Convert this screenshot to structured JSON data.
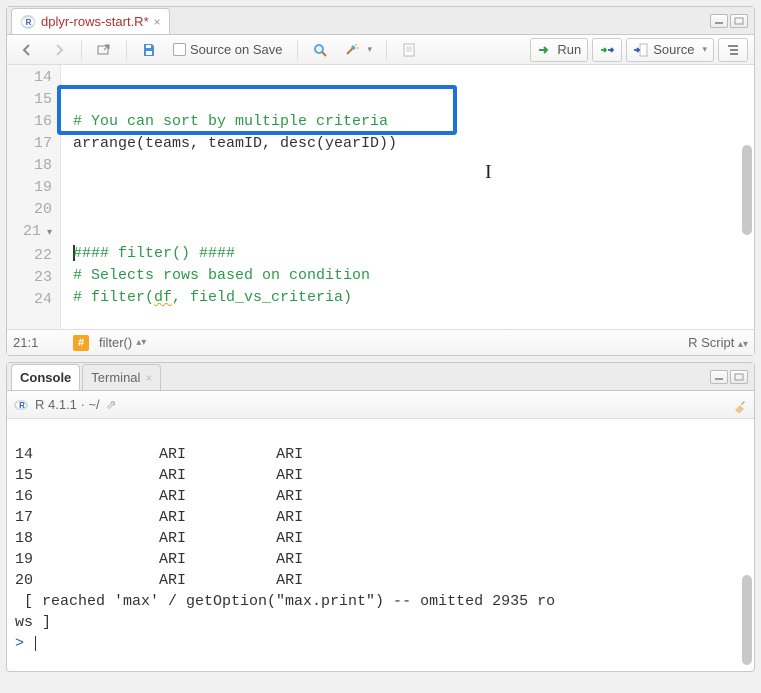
{
  "source": {
    "tab_filename": "dplyr-rows-start.R*",
    "toolbar": {
      "source_on_save": "Source on Save",
      "run": "Run",
      "source_btn": "Source"
    },
    "lines": [
      {
        "n": 14,
        "type": "blank",
        "text": ""
      },
      {
        "n": 15,
        "type": "comment",
        "text": "# You can sort by multiple criteria"
      },
      {
        "n": 16,
        "type": "code",
        "text": "arrange(teams, teamID, desc(yearID))"
      },
      {
        "n": 17,
        "type": "blank",
        "text": ""
      },
      {
        "n": 18,
        "type": "blank",
        "text": ""
      },
      {
        "n": 19,
        "type": "blank",
        "text": ""
      },
      {
        "n": 20,
        "type": "blank",
        "text": ""
      },
      {
        "n": 21,
        "type": "section",
        "text": "#### filter() ####"
      },
      {
        "n": 22,
        "type": "comment",
        "text": "# Selects rows based on condition"
      },
      {
        "n": 23,
        "type": "comment_wavy",
        "prefix": "# filter(",
        "wavy": "df",
        "suffix": ", field_vs_criteria)"
      },
      {
        "n": 24,
        "type": "blank",
        "text": ""
      }
    ],
    "status": {
      "pos": "21:1",
      "section": "filter()",
      "lang": "R Script"
    }
  },
  "console": {
    "tabs": {
      "console": "Console",
      "terminal": "Terminal"
    },
    "header": "R 4.1.1 · ~/",
    "rows": [
      {
        "n": "14",
        "a": "ARI",
        "b": "ARI"
      },
      {
        "n": "15",
        "a": "ARI",
        "b": "ARI"
      },
      {
        "n": "16",
        "a": "ARI",
        "b": "ARI"
      },
      {
        "n": "17",
        "a": "ARI",
        "b": "ARI"
      },
      {
        "n": "18",
        "a": "ARI",
        "b": "ARI"
      },
      {
        "n": "19",
        "a": "ARI",
        "b": "ARI"
      },
      {
        "n": "20",
        "a": "ARI",
        "b": "ARI"
      }
    ],
    "footer1": " [ reached 'max' / getOption(\"max.print\") -- omitted 2935 ro",
    "footer2": "ws ]",
    "prompt": ">"
  }
}
